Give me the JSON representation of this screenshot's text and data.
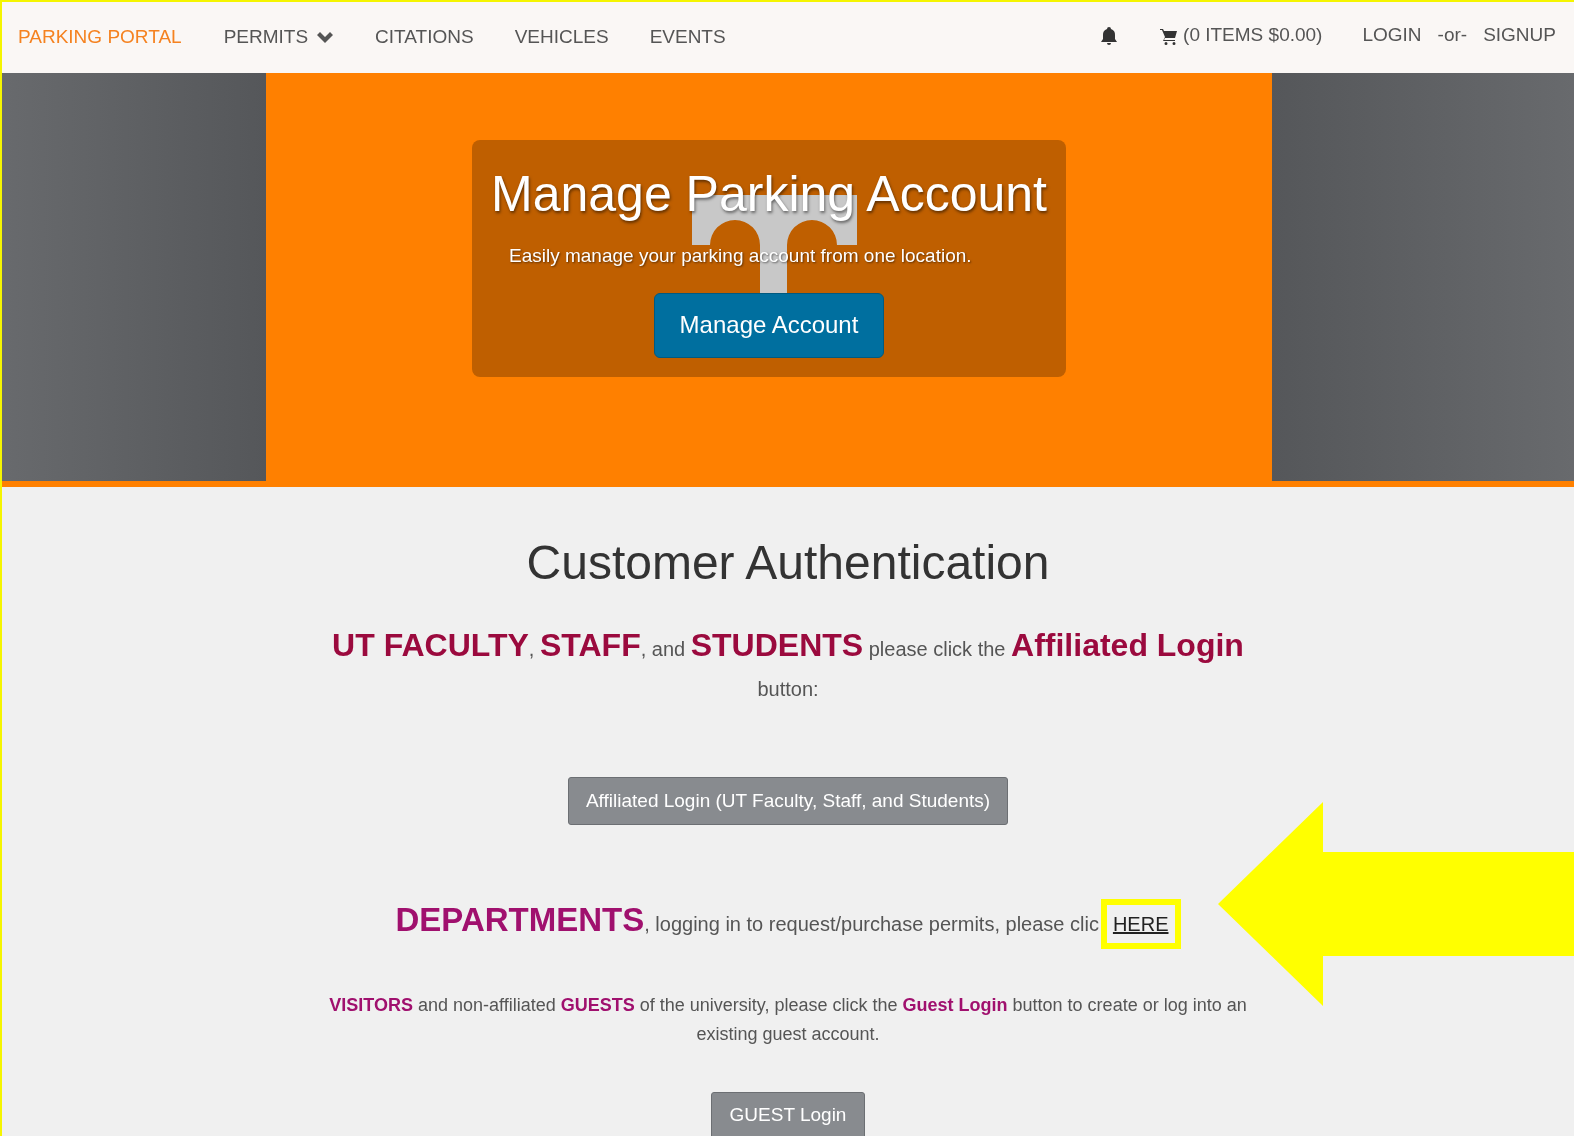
{
  "nav": {
    "brand": "PARKING PORTAL",
    "items": [
      {
        "label": "PERMITS",
        "dropdown": true
      },
      {
        "label": "CITATIONS",
        "dropdown": false
      },
      {
        "label": "VEHICLES",
        "dropdown": false
      },
      {
        "label": "EVENTS",
        "dropdown": false
      }
    ],
    "cart": "(0 ITEMS $0.00)",
    "login": "LOGIN",
    "separator": "-or-",
    "signup": "SIGNUP"
  },
  "hero": {
    "title": "Manage Parking Account",
    "subtitle": "Easily manage your parking account from one location.",
    "button": "Manage Account"
  },
  "auth": {
    "title": "Customer Authentication",
    "affiliated_text": "**UT FACULTY**, **STAFF**, and **STUDENTS** please click the **Affiliated Login** button:",
    "affiliated_button": "Affiliated Login (UT Faculty, Staff, and Students)",
    "departments_text": "**DEPARTMENTS**, logging in to request/purchase permits, please clic",
    "departments_link": "HERE",
    "visitors_text": "**VISITORS** and non-affiliated **GUESTS** of the university, please click the **Guest Login** button to create or log into an existing guest account.",
    "guest_button": "GUEST Login"
  }
}
